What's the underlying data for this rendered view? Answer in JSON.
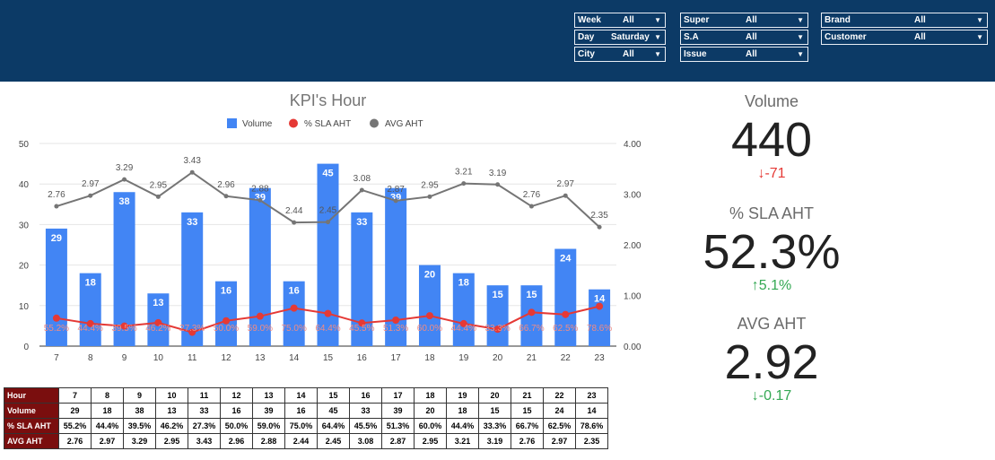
{
  "filters": [
    {
      "label": "Week",
      "value": "All"
    },
    {
      "label": "Day",
      "value": "Saturday"
    },
    {
      "label": "City",
      "value": "All"
    },
    {
      "label": "Super",
      "value": "All"
    },
    {
      "label": "S.A",
      "value": "All"
    },
    {
      "label": "Issue",
      "value": "All"
    },
    {
      "label": "Brand",
      "value": "All"
    },
    {
      "label": "Customer",
      "value": "All"
    }
  ],
  "chart_data": {
    "type": "bar",
    "title": "KPI's Hour",
    "categories": [
      "7",
      "8",
      "9",
      "10",
      "11",
      "12",
      "13",
      "14",
      "15",
      "16",
      "17",
      "18",
      "19",
      "20",
      "21",
      "22",
      "23"
    ],
    "series": [
      {
        "name": "Volume",
        "type": "bar",
        "axis": "left",
        "color": "#4285f4",
        "values": [
          29,
          18,
          38,
          13,
          33,
          16,
          39,
          16,
          45,
          33,
          39,
          20,
          18,
          15,
          15,
          24,
          14
        ]
      },
      {
        "name": "% SLA AHT",
        "type": "line",
        "axis": "right",
        "color": "#e53935",
        "labels": [
          "55.2%",
          "44.4%",
          "39.5%",
          "46.2%",
          "27.3%",
          "50.0%",
          "59.0%",
          "75.0%",
          "64.4%",
          "45.5%",
          "51.3%",
          "60.0%",
          "44.4%",
          "33.3%",
          "66.7%",
          "62.5%",
          "78.6%"
        ],
        "values": [
          0.552,
          0.444,
          0.395,
          0.462,
          0.273,
          0.5,
          0.59,
          0.75,
          0.644,
          0.455,
          0.513,
          0.6,
          0.444,
          0.333,
          0.667,
          0.625,
          0.786
        ]
      },
      {
        "name": "AVG AHT",
        "type": "line",
        "axis": "right",
        "color": "#757575",
        "values": [
          2.76,
          2.97,
          3.29,
          2.95,
          3.43,
          2.96,
          2.88,
          2.44,
          2.45,
          3.08,
          2.87,
          2.95,
          3.21,
          3.19,
          2.76,
          2.97,
          2.35
        ]
      }
    ],
    "ylim_left": [
      0,
      50
    ],
    "yticks_left": [
      "0",
      "10",
      "20",
      "30",
      "40",
      "50"
    ],
    "ylim_right": [
      0,
      4
    ],
    "yticks_right": [
      "0.00",
      "1.00",
      "2.00",
      "3.00",
      "4.00"
    ],
    "legend_position": "top",
    "grid": true
  },
  "kpis": [
    {
      "label": "Volume",
      "value": "440",
      "delta": "-71",
      "direction": "down",
      "color": "#e53935"
    },
    {
      "label": "% SLA AHT",
      "value": "52.3%",
      "delta": "5.1%",
      "direction": "up",
      "color": "#34a853"
    },
    {
      "label": "AVG AHT",
      "value": "2.92",
      "delta": "-0.17",
      "direction": "down",
      "color": "#34a853"
    }
  ],
  "table": {
    "rows": [
      {
        "head": "Hour",
        "cells": [
          "7",
          "8",
          "9",
          "10",
          "11",
          "12",
          "13",
          "14",
          "15",
          "16",
          "17",
          "18",
          "19",
          "20",
          "21",
          "22",
          "23"
        ]
      },
      {
        "head": "Volume",
        "cells": [
          "29",
          "18",
          "38",
          "13",
          "33",
          "16",
          "39",
          "16",
          "45",
          "33",
          "39",
          "20",
          "18",
          "15",
          "15",
          "24",
          "14"
        ]
      },
      {
        "head": "% SLA AHT",
        "cells": [
          "55.2%",
          "44.4%",
          "39.5%",
          "46.2%",
          "27.3%",
          "50.0%",
          "59.0%",
          "75.0%",
          "64.4%",
          "45.5%",
          "51.3%",
          "60.0%",
          "44.4%",
          "33.3%",
          "66.7%",
          "62.5%",
          "78.6%"
        ]
      },
      {
        "head": "AVG AHT",
        "cells": [
          "2.76",
          "2.97",
          "3.29",
          "2.95",
          "3.43",
          "2.96",
          "2.88",
          "2.44",
          "2.45",
          "3.08",
          "2.87",
          "2.95",
          "3.21",
          "3.19",
          "2.76",
          "2.97",
          "2.35"
        ]
      }
    ]
  },
  "icons": {
    "dropdown": "chevron-down-icon",
    "up": "arrow-up-icon",
    "down": "arrow-down-icon"
  }
}
